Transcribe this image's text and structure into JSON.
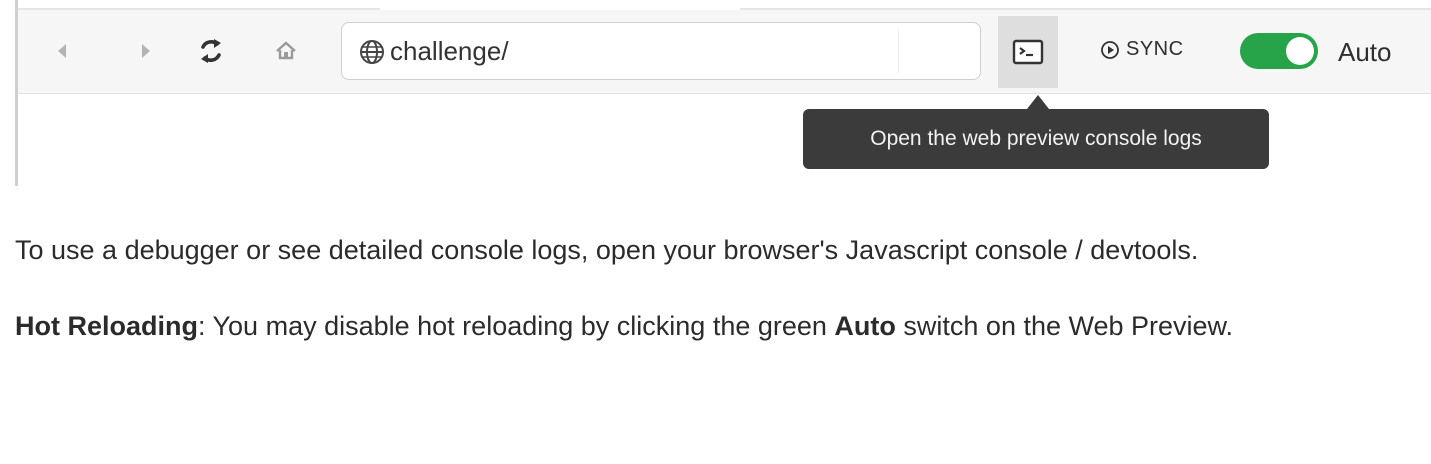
{
  "toolbar": {
    "back_icon": "chevron-left-icon",
    "forward_icon": "chevron-right-icon",
    "reload_icon": "reload-icon",
    "home_icon": "home-icon",
    "url": {
      "icon": "globe-icon",
      "value": "challenge/"
    },
    "console_icon": "terminal-icon",
    "sync_label": "SYNC",
    "auto_toggle": {
      "state": "on",
      "color": "#27a44a",
      "label": "Auto"
    }
  },
  "tooltip": {
    "text": "Open the web preview console logs"
  },
  "doc": {
    "para1": "To use a debugger or see detailed console logs, open your browser's Javascript console / devtools.",
    "para2": {
      "bold_term": "Hot Reloading",
      "text_a": ": You may disable hot reloading by clicking the green ",
      "bold_auto": "Auto",
      "text_b": " switch on the Web Preview."
    }
  }
}
